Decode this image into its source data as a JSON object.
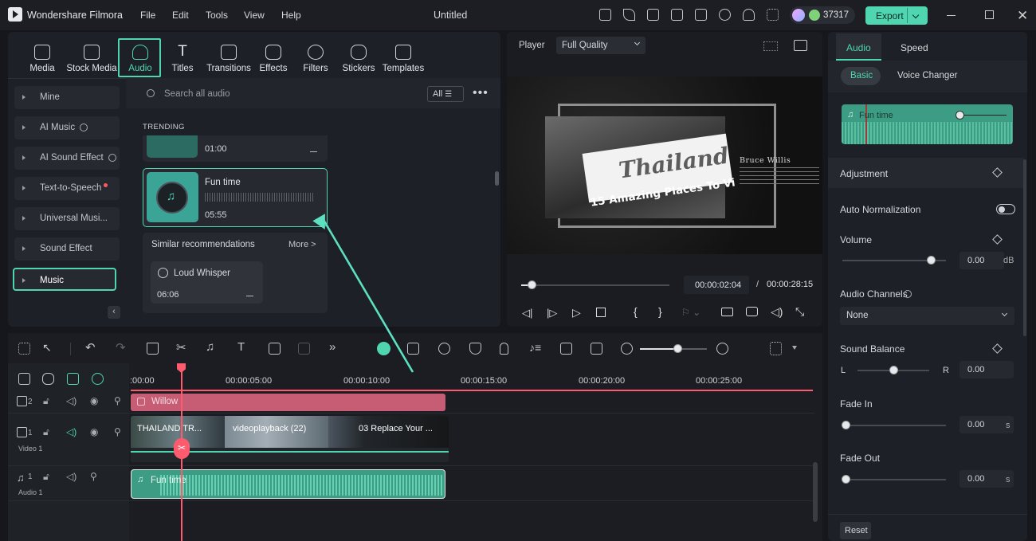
{
  "app": {
    "name": "Wondershare Filmora",
    "title": "Untitled",
    "credits": "37317",
    "export_label": "Export"
  },
  "menu": [
    "File",
    "Edit",
    "Tools",
    "View",
    "Help"
  ],
  "toolbar": [
    "Media",
    "Stock Media",
    "Audio",
    "Titles",
    "Transitions",
    "Effects",
    "Filters",
    "Stickers",
    "Templates"
  ],
  "categories": [
    {
      "label": "Mine"
    },
    {
      "label": "AI Music"
    },
    {
      "label": "AI Sound Effect"
    },
    {
      "label": "Text-to-Speech"
    },
    {
      "label": "Universal Musi..."
    },
    {
      "label": "Sound Effect"
    },
    {
      "label": "Music"
    }
  ],
  "browser": {
    "search_placeholder": "Search all audio",
    "filter_label": "All",
    "section": "TRENDING",
    "prev_item_duration": "01:00",
    "item": {
      "title": "Fun time",
      "duration": "05:55"
    },
    "similar": {
      "heading": "Similar recommendations",
      "more": "More >",
      "item_title": "Loud Whisper",
      "item_duration": "06:06"
    }
  },
  "player": {
    "label": "Player",
    "quality": "Full Quality",
    "preview_title": "Thailand",
    "preview_subtitle": "15 Amazing Places To Vi",
    "preview_author": "Bruce Willis",
    "current_time": "00:00:02:04",
    "separator": "/",
    "total_time": "00:00:28:15",
    "progress": 0.07
  },
  "inspector": {
    "tabs": [
      "Audio",
      "Speed"
    ],
    "subtabs": [
      "Basic",
      "Voice Changer"
    ],
    "clip_name": "Fun time",
    "adjustment": "Adjustment",
    "auto_normalization": "Auto Normalization",
    "volume": {
      "label": "Volume",
      "value": "0.00",
      "unit": "dB",
      "level": 0.85
    },
    "audio_channels": {
      "label": "Audio Channels",
      "value": "None"
    },
    "sound_balance": {
      "label": "Sound Balance",
      "left": "L",
      "right": "R",
      "value": "0.00",
      "level": 0.5
    },
    "fade_in": {
      "label": "Fade In",
      "value": "0.00",
      "unit": "s",
      "level": 0
    },
    "fade_out": {
      "label": "Fade Out",
      "value": "0.00",
      "unit": "s",
      "level": 0
    },
    "reset": "Reset"
  },
  "timeline": {
    "ticks": [
      ":00:00",
      "00:00:05:00",
      "00:00:10:00",
      "00:00:15:00",
      "00:00:20:00",
      "00:00:25:00"
    ],
    "tracks": {
      "video_label": "Video 1",
      "audio_label": "Audio 1",
      "track2_num": "2",
      "track1_num": "1",
      "audio_num": "1"
    },
    "clips": {
      "title_clip": "Willow",
      "video_clips": [
        "THAILAND TR...",
        "videoplayback (22)",
        "03 Replace Your ..."
      ],
      "audio_clip": "Fun time"
    }
  },
  "colors": {
    "accent": "#4fd6b0",
    "playhead": "#ff5b6e",
    "title_clip": "#c65d74",
    "audio_clip": "#3d9d84"
  }
}
